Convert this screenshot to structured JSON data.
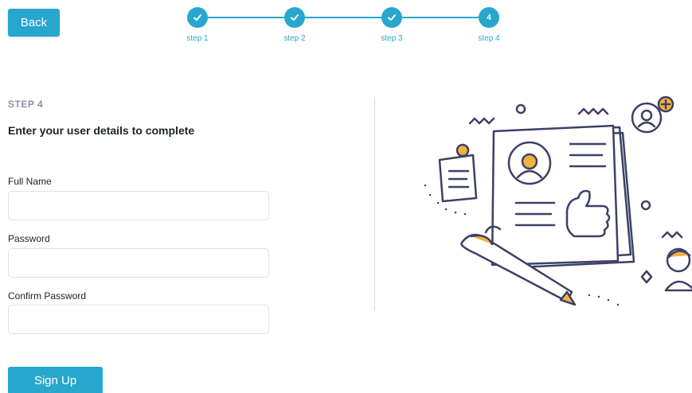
{
  "header": {
    "back_label": "Back"
  },
  "stepper": {
    "steps": [
      {
        "label": "step 1",
        "state": "done"
      },
      {
        "label": "step 2",
        "state": "done"
      },
      {
        "label": "step 3",
        "state": "done"
      },
      {
        "label": "step 4",
        "state": "current",
        "number": "4"
      }
    ]
  },
  "form": {
    "step_title": "STEP 4",
    "subtitle": "Enter your user details to complete",
    "fields": {
      "full_name": {
        "label": "Full Name",
        "value": ""
      },
      "password": {
        "label": "Password",
        "value": ""
      },
      "confirm_password": {
        "label": "Confirm Password",
        "value": ""
      }
    },
    "submit_label": "Sign Up"
  },
  "colors": {
    "accent": "#27a7cd",
    "illustration_stroke": "#3c4166",
    "illustration_accent": "#f5b041"
  }
}
